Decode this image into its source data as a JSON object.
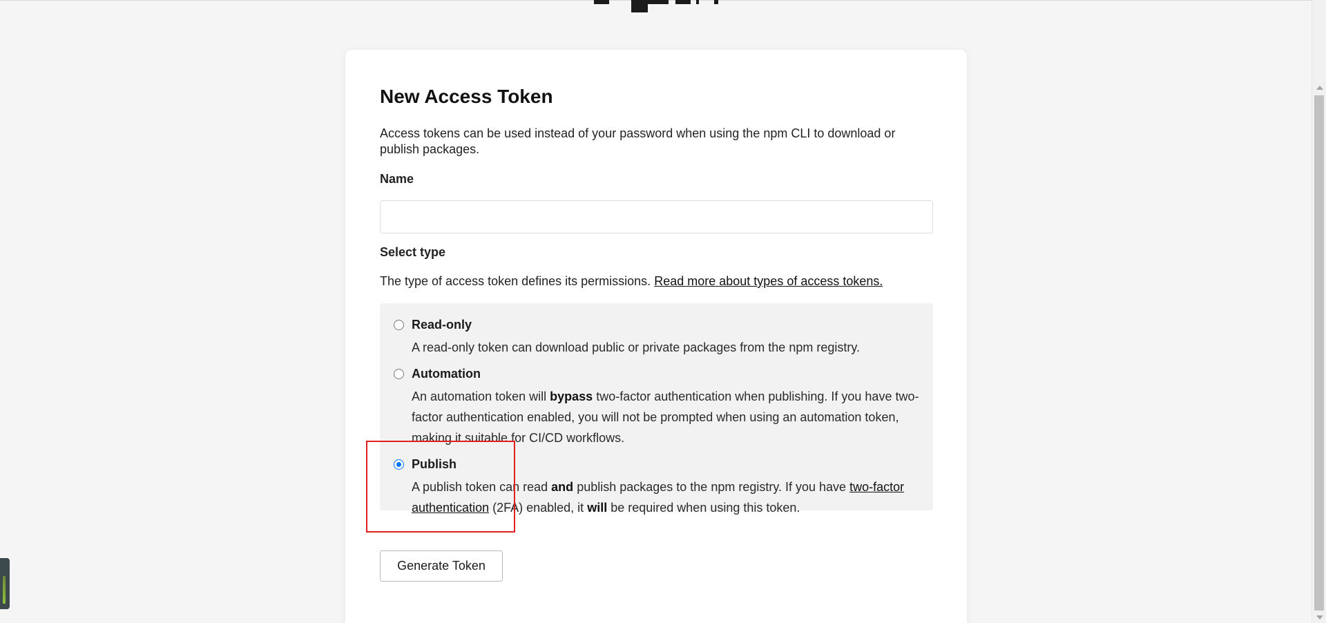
{
  "form": {
    "title": "New Access Token",
    "intro": "Access tokens can be used instead of your password when using the npm CLI to download or publish packages.",
    "name_label": "Name",
    "name_value": "",
    "name_placeholder": "",
    "type_label": "Select type",
    "type_desc_prefix": "The type of access token defines its permissions.",
    "type_desc_link": "Read more about types of access tokens.",
    "submit_label": "Generate Token"
  },
  "options": [
    {
      "id": "read-only",
      "title": "Read-only",
      "desc": "A read-only token can download public or private packages from the npm registry.",
      "checked": false
    },
    {
      "id": "automation",
      "title": "Automation",
      "desc_1": "An automation token will",
      "desc_bold": "bypass",
      "desc_2": "two-factor authentication when publishing. If you have two-factor authentication enabled, you will not be prompted when using an automation token, making it suitable for CI/CD workflows.",
      "checked": false
    },
    {
      "id": "publish",
      "title": "Publish",
      "desc_1": "A publish token can read",
      "desc_bold_1": "and",
      "desc_2": "publish packages to the npm registry. If you have",
      "desc_link": "two-factor authentication",
      "desc_3": "(2FA) enabled, it",
      "desc_bold_2": "will",
      "desc_4": "be required when using this token.",
      "checked": true
    }
  ],
  "colors": {
    "page_bg": "#f5f5f5",
    "card_bg": "#ffffff",
    "options_bg": "#f2f2f2",
    "radio_checked": "#0075ff",
    "highlight": "#e02020"
  },
  "icons": {
    "logo": "npm-logo-fragment"
  }
}
